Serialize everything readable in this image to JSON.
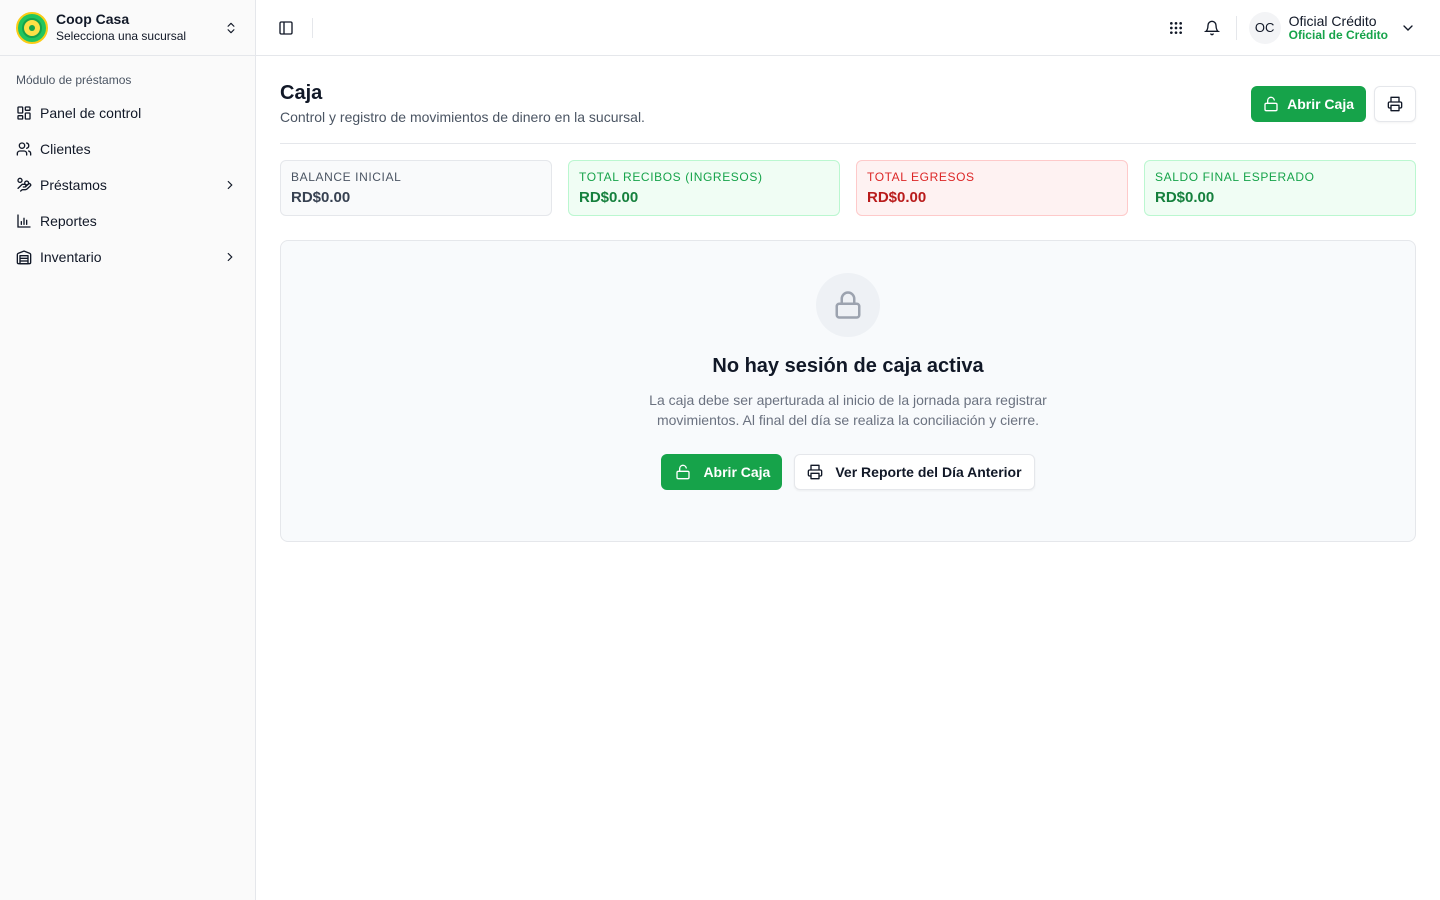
{
  "brand": {
    "name": "Coop Casa",
    "subtitle": "Selecciona una sucursal"
  },
  "sidebar": {
    "section_label": "Módulo de préstamos",
    "items": [
      {
        "label": "Panel de control",
        "icon": "dashboard-icon"
      },
      {
        "label": "Clientes",
        "icon": "users-icon"
      },
      {
        "label": "Préstamos",
        "icon": "hand-coins-icon",
        "expandable": true
      },
      {
        "label": "Reportes",
        "icon": "bar-chart-icon"
      },
      {
        "label": "Inventario",
        "icon": "warehouse-icon",
        "expandable": true
      }
    ]
  },
  "user": {
    "initials": "OC",
    "name": "Oficial Crédito",
    "role": "Oficial de Crédito"
  },
  "page": {
    "title": "Caja",
    "subtitle": "Control y registro de movimientos de dinero en la sucursal.",
    "open_button": "Abrir Caja"
  },
  "stats": [
    {
      "label": "Balance Inicial",
      "value": "RD$0.00",
      "tone": "neutral"
    },
    {
      "label": "Total Recibos (Ingresos)",
      "value": "RD$0.00",
      "tone": "green"
    },
    {
      "label": "Total Egresos",
      "value": "RD$0.00",
      "tone": "red"
    },
    {
      "label": "Saldo Final Esperado",
      "value": "RD$0.00",
      "tone": "green"
    }
  ],
  "empty_state": {
    "title": "No hay sesión de caja activa",
    "description": "La caja debe ser aperturada al inicio de la jornada para registrar movimientos. Al final del día se realiza la conciliación y cierre.",
    "primary_button": "Abrir Caja",
    "secondary_button": "Ver Reporte del Día Anterior"
  },
  "colors": {
    "accent": "#16a34a",
    "danger": "#dc2626"
  }
}
